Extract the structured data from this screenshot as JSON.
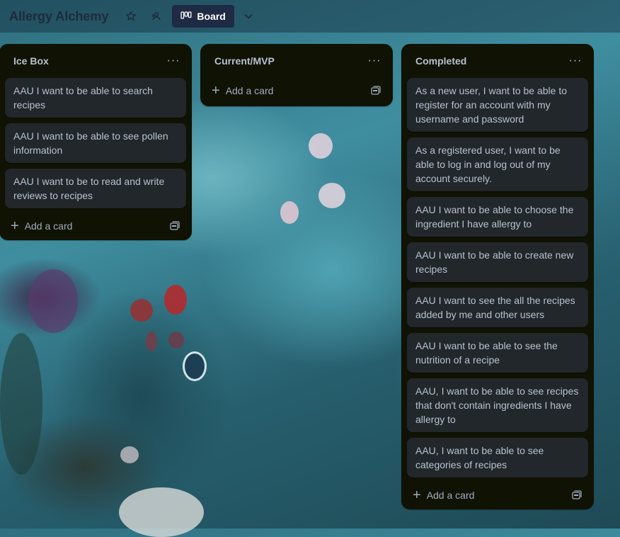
{
  "header": {
    "board_title": "Allergy Alchemy",
    "star_icon": "star-icon",
    "visibility_icon": "workspace-visibility-icon",
    "view_button_label": "Board",
    "view_icon": "board-view-icon",
    "view_dropdown_icon": "chevron-down-icon"
  },
  "lists": [
    {
      "title": "Ice Box",
      "menu_label": "···",
      "cards": [
        "AAU I want to be able to search recipes",
        "AAU I want to be able to see pollen information",
        "AAU I want to be to read and write reviews to recipes"
      ],
      "add_card_label": "Add a card"
    },
    {
      "title": "Current/MVP",
      "menu_label": "···",
      "cards": [],
      "add_card_label": "Add a card"
    },
    {
      "title": "Completed",
      "menu_label": "···",
      "cards": [
        "As a new user, I want to be able to register for an account with my username and password",
        "As a registered user, I want to be able to log in and log out of my account securely.",
        "AAU I want to be able to choose the ingredient I have allergy to",
        "AAU I want to be able to create new recipes",
        "AAU I want to see the all the recipes added by me and other users",
        "AAU I want to be able to see the nutrition of a recipe",
        "AAU, I want to be able to see recipes that don't contain ingredients I have allergy to",
        "AAU, I want to be able to see categories of recipes"
      ],
      "add_card_label": "Add a card"
    }
  ],
  "colors": {
    "list_bg": "#101204",
    "card_bg": "#22272b",
    "card_text": "#b6c2cf",
    "board_button_bg": "#1f2a44"
  }
}
